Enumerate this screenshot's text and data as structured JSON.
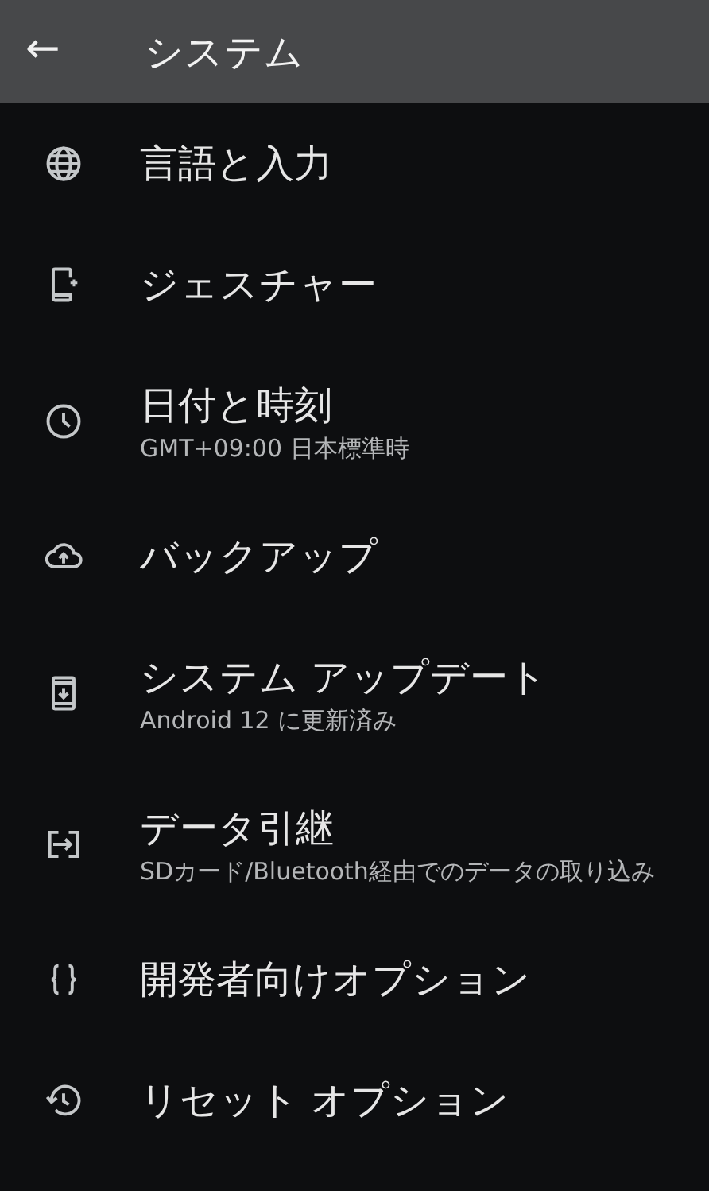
{
  "app_bar": {
    "back": "←",
    "title": "システム"
  },
  "items": [
    {
      "kind": "globe",
      "title": "言語と入力"
    },
    {
      "kind": "gesture",
      "title": "ジェスチャー"
    },
    {
      "kind": "clock",
      "title": "日付と時刻",
      "summary": "GMT+09:00 日本標準時"
    },
    {
      "kind": "cloud",
      "title": "バックアップ"
    },
    {
      "kind": "update",
      "title": "システム アップデート",
      "summary": "Android 12 に更新済み"
    },
    {
      "kind": "transfer",
      "title": "データ引継",
      "summary": "SDカード/Bluetooth経由でのデータの取り込み"
    },
    {
      "kind": "braces",
      "title": "開発者向けオプション"
    },
    {
      "kind": "history",
      "title": "リセット オプション"
    }
  ]
}
